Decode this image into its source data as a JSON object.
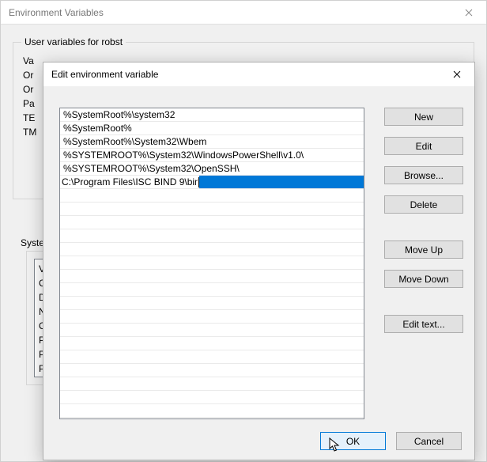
{
  "parent": {
    "title": "Environment Variables",
    "user_group_label": "User variables for robst",
    "user_vars_peek": [
      "Va",
      "Or",
      "Or",
      "Pa",
      "TE",
      "TM"
    ],
    "system_group_label": "Syste",
    "system_vars_peek": [
      "Va",
      "Co",
      "Dr",
      "NU",
      "OS",
      "Pa",
      "PA",
      "PR"
    ]
  },
  "dialog": {
    "title": "Edit environment variable",
    "entries": [
      "%SystemRoot%\\system32",
      "%SystemRoot%",
      "%SystemRoot%\\System32\\Wbem",
      "%SYSTEMROOT%\\System32\\WindowsPowerShell\\v1.0\\",
      "%SYSTEMROOT%\\System32\\OpenSSH\\",
      "C:\\Program Files\\ISC BIND 9\\bin"
    ],
    "selected_index": 5,
    "buttons": {
      "new": "New",
      "edit": "Edit",
      "browse": "Browse...",
      "delete": "Delete",
      "move_up": "Move Up",
      "move_down": "Move Down",
      "edit_text": "Edit text..."
    },
    "footer": {
      "ok": "OK",
      "cancel": "Cancel"
    }
  },
  "colors": {
    "selection": "#0078d7",
    "button_bg": "#e1e1e1",
    "button_border": "#adadad",
    "window_bg": "#f0f0f0"
  }
}
